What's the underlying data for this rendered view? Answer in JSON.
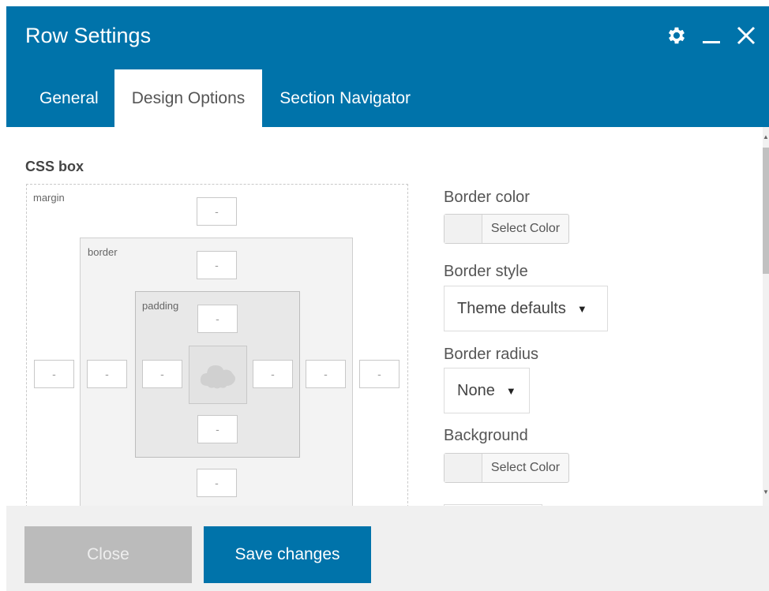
{
  "dialog": {
    "title": "Row Settings",
    "icons": [
      "gear-icon",
      "minimize-icon",
      "close-icon"
    ]
  },
  "tabs": [
    {
      "label": "General",
      "active": false
    },
    {
      "label": "Design Options",
      "active": true
    },
    {
      "label": "Section Navigator",
      "active": false
    }
  ],
  "css_box": {
    "section_label": "CSS box",
    "margin_label": "margin",
    "border_label": "border",
    "padding_label": "padding",
    "margin_top": "-",
    "border_top": "-",
    "padding_top": "-",
    "margin_left": "-",
    "border_left": "-",
    "padding_left": "-",
    "padding_right": "-",
    "border_right": "-",
    "margin_right": "-",
    "padding_bottom": "-",
    "border_bottom": "-",
    "content_icon": "cloud-placeholder-icon"
  },
  "options": {
    "border_color_label": "Border color",
    "border_color_button": "Select Color",
    "border_style_label": "Border style",
    "border_style_value": "Theme defaults",
    "border_radius_label": "Border radius",
    "border_radius_value": "None",
    "background_label": "Background",
    "background_button": "Select Color"
  },
  "footer": {
    "close_label": "Close",
    "save_label": "Save changes"
  },
  "colors": {
    "header": "#0073aa",
    "save_button": "#0073aa",
    "close_button": "#bbbbbb"
  }
}
